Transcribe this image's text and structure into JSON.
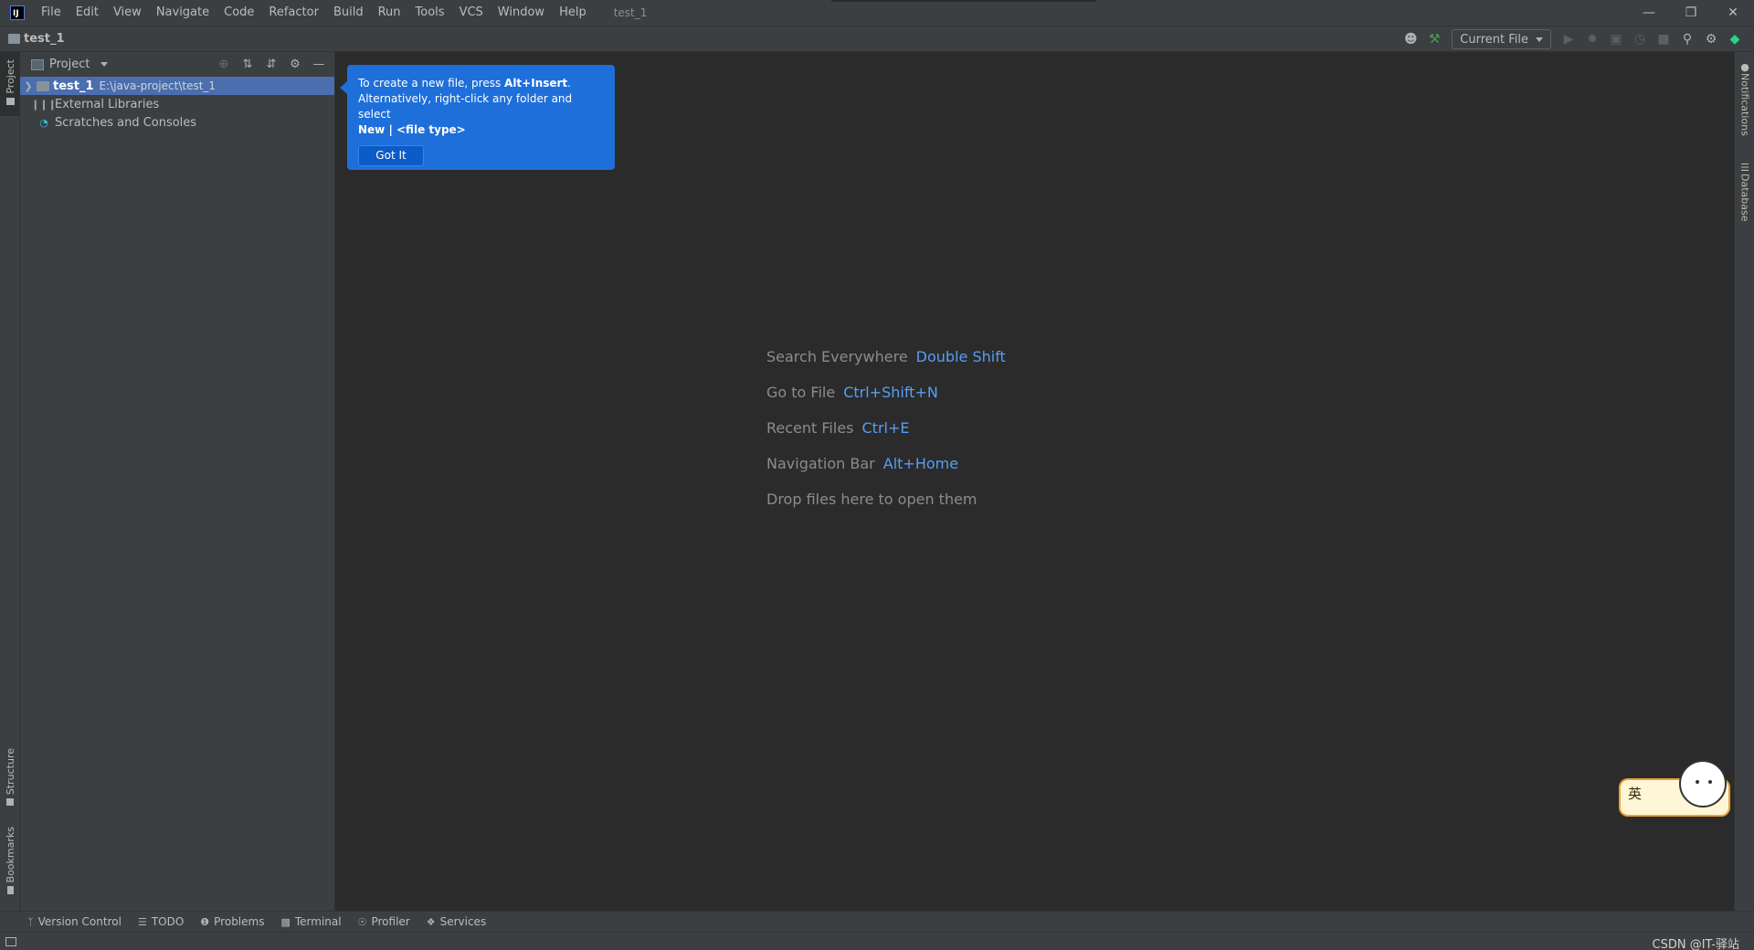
{
  "titlebar": {
    "logo_text": "IJ",
    "menu": [
      "File",
      "Edit",
      "View",
      "Navigate",
      "Code",
      "Refactor",
      "Build",
      "Run",
      "Tools",
      "VCS",
      "Window",
      "Help"
    ],
    "window_title": "test_1",
    "window_buttons": [
      "minimize",
      "restore",
      "close"
    ]
  },
  "navbar": {
    "breadcrumb": "test_1",
    "run_config": "Current File",
    "icons": [
      "user-icon",
      "build-hammer-icon",
      "run-icon",
      "debug-icon",
      "coverage-icon",
      "profile-icon",
      "stop-icon",
      "search-icon",
      "settings-icon",
      "toolbox-icon"
    ]
  },
  "left_strip": {
    "tabs": [
      "Project",
      "Structure",
      "Bookmarks"
    ]
  },
  "right_strip": {
    "tabs": [
      "Notifications",
      "Database"
    ]
  },
  "project_panel": {
    "title": "Project",
    "tree": [
      {
        "name": "test_1",
        "path": "E:\\java-project\\test_1",
        "selected": true
      },
      {
        "name": "External Libraries"
      },
      {
        "name": "Scratches and Consoles"
      }
    ]
  },
  "balloon": {
    "line1_prefix": "To create a new file, press ",
    "line1_key": "Alt+Insert",
    "line1_suffix": ".",
    "line2": "Alternatively, right-click any folder and select",
    "line3_bold": "New | <file type>",
    "button": "Got It"
  },
  "editor_hints": [
    {
      "label": "Search Everywhere",
      "key": "Double Shift"
    },
    {
      "label": "Go to File",
      "key": "Ctrl+Shift+N"
    },
    {
      "label": "Recent Files",
      "key": "Ctrl+E"
    },
    {
      "label": "Navigation Bar",
      "key": "Alt+Home"
    },
    {
      "label": "Drop files here to open them",
      "key": ""
    }
  ],
  "bottom_tabs": [
    "Version Control",
    "TODO",
    "Problems",
    "Terminal",
    "Profiler",
    "Services"
  ],
  "status_bar": {
    "watermark": "CSDN @IT-驿站"
  },
  "ime": {
    "char": "英"
  },
  "colors": {
    "accent": "#589df6",
    "selection": "#4b6eaf",
    "balloon": "#1e6fd9",
    "background": "#2b2b2b",
    "panel": "#3c3f41"
  }
}
